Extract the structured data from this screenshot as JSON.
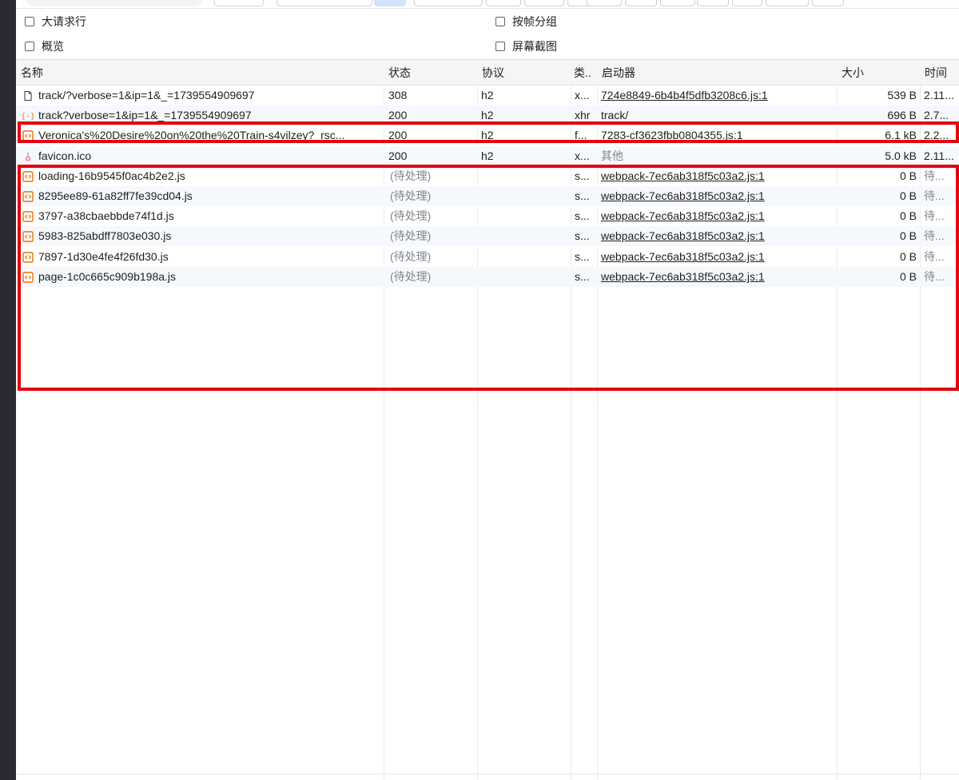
{
  "filters": {
    "big_request_rows": "大请求行",
    "group_by_frame": "按帧分组",
    "overview": "概览",
    "screenshots": "屏幕截图"
  },
  "table": {
    "headers": {
      "name": "名称",
      "status": "状态",
      "protocol": "协议",
      "type": "类..",
      "initiator": "启动器",
      "size": "大小",
      "time": "时间"
    },
    "rows": [
      {
        "icon": "document-icon",
        "name": "track/?verbose=1&ip=1&_=1739554909697",
        "status": "308",
        "protocol": "h2",
        "type": "x...",
        "initiator": "724e8849-6b4b4f5dfb3208c6.js:1",
        "size": "539 B",
        "time": "2.11..."
      },
      {
        "icon": "xhr-icon",
        "name": "track?verbose=1&ip=1&_=1739554909697",
        "status": "200",
        "protocol": "h2",
        "type": "xhr",
        "initiator": "track/",
        "size": "696 B",
        "time": "2.7..."
      },
      {
        "icon": "script-icon",
        "name": "Veronica's%20Desire%20on%20the%20Train-s4vilzey?_rsc...",
        "status": "200",
        "protocol": "h2",
        "type": "f...",
        "initiator": "7283-cf3623fbb0804355.js:1",
        "size": "6.1 kB",
        "time": "2.2..."
      },
      {
        "icon": "favicon-icon",
        "name": "favicon.ico",
        "status": "200",
        "protocol": "h2",
        "type": "x...",
        "initiator": "其他",
        "size": "5.0 kB",
        "time": "2.11..."
      },
      {
        "icon": "script-icon",
        "name": "loading-16b9545f0ac4b2e2.js",
        "status": "(待处理)",
        "protocol": "",
        "type": "s...",
        "initiator": "webpack-7ec6ab318f5c03a2.js:1",
        "size": "0 B",
        "time": "待..."
      },
      {
        "icon": "script-icon",
        "name": "8295ee89-61a82ff7fe39cd04.js",
        "status": "(待处理)",
        "protocol": "",
        "type": "s...",
        "initiator": "webpack-7ec6ab318f5c03a2.js:1",
        "size": "0 B",
        "time": "待..."
      },
      {
        "icon": "script-icon",
        "name": "3797-a38cbaebbde74f1d.js",
        "status": "(待处理)",
        "protocol": "",
        "type": "s...",
        "initiator": "webpack-7ec6ab318f5c03a2.js:1",
        "size": "0 B",
        "time": "待..."
      },
      {
        "icon": "script-icon",
        "name": "5983-825abdff7803e030.js",
        "status": "(待处理)",
        "protocol": "",
        "type": "s...",
        "initiator": "webpack-7ec6ab318f5c03a2.js:1",
        "size": "0 B",
        "time": "待..."
      },
      {
        "icon": "script-icon",
        "name": "7897-1d30e4fe4f26fd30.js",
        "status": "(待处理)",
        "protocol": "",
        "type": "s...",
        "initiator": "webpack-7ec6ab318f5c03a2.js:1",
        "size": "0 B",
        "time": "待..."
      },
      {
        "icon": "script-icon",
        "name": "page-1c0c665c909b198a.js",
        "status": "(待处理)",
        "protocol": "",
        "type": "s...",
        "initiator": "webpack-7ec6ab318f5c03a2.js:1",
        "size": "0 B",
        "time": "待..."
      }
    ]
  },
  "colors": {
    "highlight": "#e3000f",
    "script_icon": "#e8710a",
    "pending_text": "#80868b"
  }
}
